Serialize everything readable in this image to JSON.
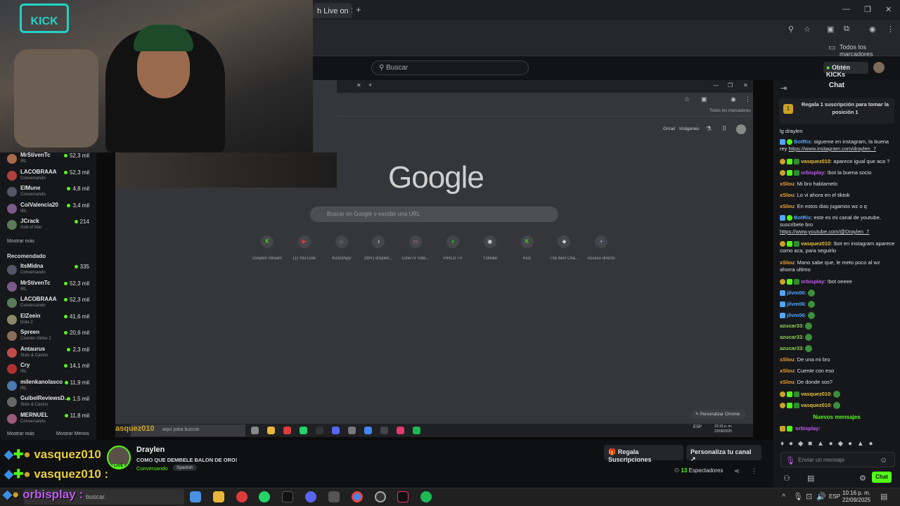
{
  "browser": {
    "tab_title": "h Live on",
    "new_tab_icon": "plus-icon",
    "bookmarks_label": "Todos los marcadores"
  },
  "kick": {
    "search_placeholder": "Buscar",
    "get_kicks_label": "Obtén KICKs"
  },
  "sidebar": {
    "following": [
      {
        "name": "MrStivenTc",
        "sub": "IRL",
        "viewers": "52,3 mil"
      },
      {
        "name": "LACOBRAAA",
        "sub": "Conversando",
        "viewers": "52,3 mil"
      },
      {
        "name": "ElMune",
        "sub": "Conversando",
        "viewers": "4,8 mil"
      },
      {
        "name": "CoiValencia20",
        "sub": "IRL",
        "viewers": "3,4 mil"
      },
      {
        "name": "JCrack",
        "sub": "God of War",
        "viewers": "214"
      }
    ],
    "show_more": "Mostrar más",
    "recommended_title": "Recomendado",
    "recommended": [
      {
        "name": "ItsMidna",
        "sub": "Conversando",
        "viewers": "335"
      },
      {
        "name": "MrStivenTc",
        "sub": "IRL",
        "viewers": "52,3 mil"
      },
      {
        "name": "LACOBRAAA",
        "sub": "Conversando",
        "viewers": "52,3 mil"
      },
      {
        "name": "ElZeein",
        "sub": "Dota 2",
        "viewers": "41,6 mil"
      },
      {
        "name": "Spreen",
        "sub": "Counter-Strike 2",
        "viewers": "20,6 mil"
      },
      {
        "name": "Antaurus",
        "sub": "Slots & Casino",
        "viewers": "2,3 mil"
      },
      {
        "name": "Cry",
        "sub": "IRL",
        "viewers": "14,1 mil"
      },
      {
        "name": "milenkanolasco",
        "sub": "IRL",
        "viewers": "11,9 mil"
      },
      {
        "name": "GuibelReviewsD...",
        "sub": "Slots & Casino",
        "viewers": "1,5 mil"
      },
      {
        "name": "MERNUEL",
        "sub": "Conversando",
        "viewers": "11,8 mil"
      }
    ],
    "show_more2": "Mostrar más",
    "show_less": "Mostrar Menos"
  },
  "webcam": {
    "logo_text": "KICK"
  },
  "inner_browser": {
    "bookmarks_label": "Todos los marcadores",
    "header_links": [
      "Gmail",
      "Imágenes"
    ],
    "logo": "Google",
    "search_placeholder": "Buscar en Google o escribir una URL",
    "shortcuts": [
      "Draylen Stream",
      "(1) YouTube",
      "KickstApp",
      "(99+) draylen...",
      "CineTV Vide...",
      "PIRLO TV",
      "Y2Mate",
      "Kick",
      "The best Cha...",
      "Acceso directo"
    ],
    "personalize": "Personalizar Chrome",
    "taskbar_search": "aquí para buscar",
    "clock": "10:16 p. m.",
    "date": "22/09/2025",
    "lang": "ESP"
  },
  "chat": {
    "title": "Chat",
    "gift_text": "Regala 1 suscripción para tomar la posición 1",
    "messages": [
      {
        "user": "",
        "text": "lg draylen",
        "color": "#e0e0e0"
      },
      {
        "user": "BotRix",
        "text": "sigueme en instagram, la buena rey ",
        "link": "https://www.instagram.com/draylen_7",
        "color": "#53a6fc"
      },
      {
        "user": "vasquez010",
        "text": "aparece igual que aca ?",
        "color": "#e8c23a"
      },
      {
        "user": "orbisplay",
        "text": "!bot la buena socio",
        "color": "#c05cf0"
      },
      {
        "user": "xSlou",
        "text": "Mi bro hablamelo",
        "color": "#f0a030"
      },
      {
        "user": "xSlou",
        "text": "Lo vi ahora en el tiktok",
        "color": "#f0a030"
      },
      {
        "user": "xSlou",
        "text": "En estos dias jugamos wz o q",
        "color": "#f0a030"
      },
      {
        "user": "BotRix",
        "text": "este es mi canal de youtube, suscribete bro ",
        "link": "https://www.youtube.com/@Draylen_7",
        "color": "#53a6fc"
      },
      {
        "user": "vasquez010",
        "text": "!bot en instagram aparece como aca, para seguirlo",
        "color": "#e8c23a"
      },
      {
        "user": "xSlou",
        "text": "Mano sabe que, le meto poco al wz ahorra ultimo",
        "color": "#f0a030"
      },
      {
        "user": "orbisplay",
        "text": "!bot oeeee",
        "color": "#c05cf0"
      },
      {
        "user": "jilvm06",
        "text": "",
        "color": "#53a6fc"
      },
      {
        "user": "jilvm06",
        "text": "",
        "color": "#53a6fc"
      },
      {
        "user": "jilvm06",
        "text": "",
        "color": "#53a6fc"
      },
      {
        "user": "azucar33",
        "text": "",
        "color": "#8fd14f"
      },
      {
        "user": "azucar33",
        "text": "",
        "color": "#8fd14f"
      },
      {
        "user": "azucar33",
        "text": "",
        "color": "#8fd14f"
      },
      {
        "user": "xSlou",
        "text": "De una mi bro",
        "color": "#f0a030"
      },
      {
        "user": "xSlou",
        "text": "Cuente con eso",
        "color": "#f0a030"
      },
      {
        "user": "xSlou",
        "text": "De donde sos?",
        "color": "#f0a030"
      },
      {
        "user": "vasquez010",
        "text": "",
        "color": "#e8c23a"
      },
      {
        "user": "vasquez010",
        "text": "",
        "color": "#e8c23a"
      }
    ],
    "new_messages": "Nuevos mensajes",
    "last_user": "orbisplay",
    "input_placeholder": "Enviar un mensaje",
    "send_label": "Chat"
  },
  "overlay": {
    "line1": "vasquez010",
    "line2": "vasquez010",
    "line3": "orbisplay",
    "inner_overlay": "asquez010"
  },
  "stream": {
    "streamer": "Draylen",
    "title": "COMO QUE DEMBELE BALON DE ORO!",
    "category": "Conversando",
    "language": "Spanish",
    "gift_subs": "Regala Suscripciones",
    "customize": "Personaliza tu canal",
    "viewers_count": "13",
    "viewers_label": "Espectadores",
    "live_badge": "LIVE"
  },
  "taskbar": {
    "search_placeholder": "buscar.",
    "lang": "ESP",
    "time": "10:16 p. m.",
    "date": "22/09/2025"
  },
  "colors": {
    "kick_green": "#53fc18",
    "overlay_yellow": "#e8d03a"
  }
}
